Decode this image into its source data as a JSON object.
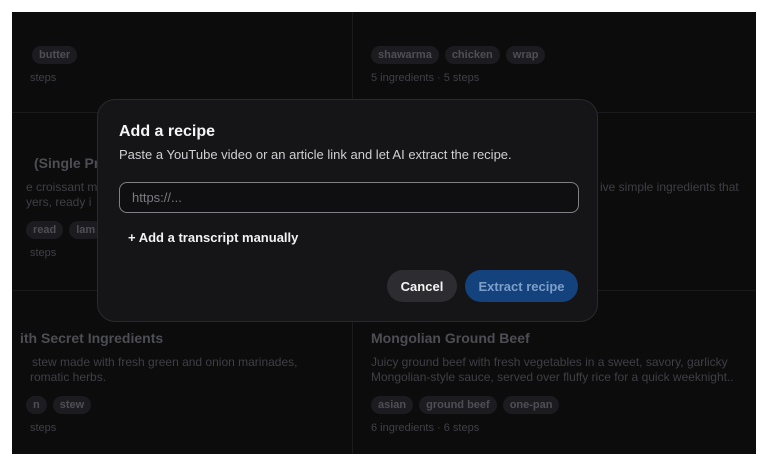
{
  "background_cards": {
    "top_left": {
      "tags": [
        "butter"
      ],
      "meta": "steps"
    },
    "top_right": {
      "tags": [
        "shawarma",
        "chicken",
        "wrap"
      ],
      "meta": "5 ingredients · 5 steps"
    },
    "mid_left": {
      "title": "(Single Pro",
      "desc_lines": [
        "e croissant m",
        "yers, ready i"
      ],
      "tags": [
        "read",
        "lam"
      ],
      "meta": "steps"
    },
    "mid_right": {
      "desc_lines": [
        "ive simple ingredients that"
      ]
    },
    "bottom_left": {
      "title": "ith Secret Ingredients",
      "desc_lines": [
        "stew made with fresh green and onion marinades,",
        "romatic herbs."
      ],
      "tags": [
        "n",
        "stew"
      ],
      "meta": "steps"
    },
    "bottom_right": {
      "title": "Mongolian Ground Beef",
      "desc_lines": [
        "Juicy ground beef with fresh vegetables in a sweet, savory, garlicky",
        "Mongolian-style sauce, served over fluffy rice for a quick weeknight.."
      ],
      "tags": [
        "asian",
        "ground beef",
        "one-pan"
      ],
      "meta": "6 ingredients · 6 steps"
    }
  },
  "modal": {
    "title": "Add a recipe",
    "subtitle": "Paste a YouTube video or an article link and let AI extract the recipe.",
    "url_input": {
      "value": "",
      "placeholder": "https://..."
    },
    "add_transcript_label": "+ Add a transcript manually",
    "cancel_label": "Cancel",
    "extract_label": "Extract recipe"
  },
  "colors": {
    "backdrop": "#0c0c0d",
    "modal_bg": "#151517",
    "accent": "#13427c",
    "accent_text": "#7e9fca"
  }
}
